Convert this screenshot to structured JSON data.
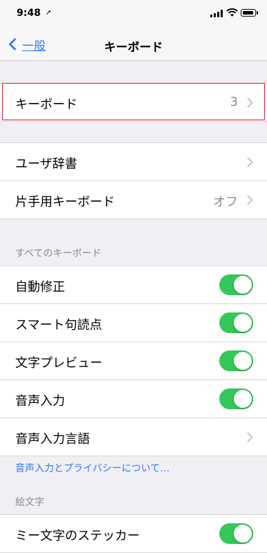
{
  "status_bar": {
    "time": "9:48"
  },
  "nav": {
    "back_label": "一般",
    "title": "キーボード"
  },
  "group1": {
    "keyboards_label": "キーボード",
    "keyboards_value": "3"
  },
  "group2": {
    "user_dictionary_label": "ユーザ辞書",
    "one_handed_label": "片手用キーボード",
    "one_handed_value": "オフ"
  },
  "all_keyboards": {
    "header": "すべてのキーボード",
    "items": [
      {
        "label": "自動修正",
        "on": true
      },
      {
        "label": "スマート句読点",
        "on": true
      },
      {
        "label": "文字プレビュー",
        "on": true
      },
      {
        "label": "音声入力",
        "on": true
      }
    ],
    "dictation_language_label": "音声入力言語",
    "privacy_link": "音声入力とプライバシーについて…"
  },
  "emoji": {
    "header": "絵文字",
    "memoji_stickers_label": "ミー文字のステッカー",
    "memoji_on": true
  },
  "colors": {
    "accent": "#3478f6",
    "toggle_on": "#34c759",
    "highlight": "#e8182e"
  }
}
